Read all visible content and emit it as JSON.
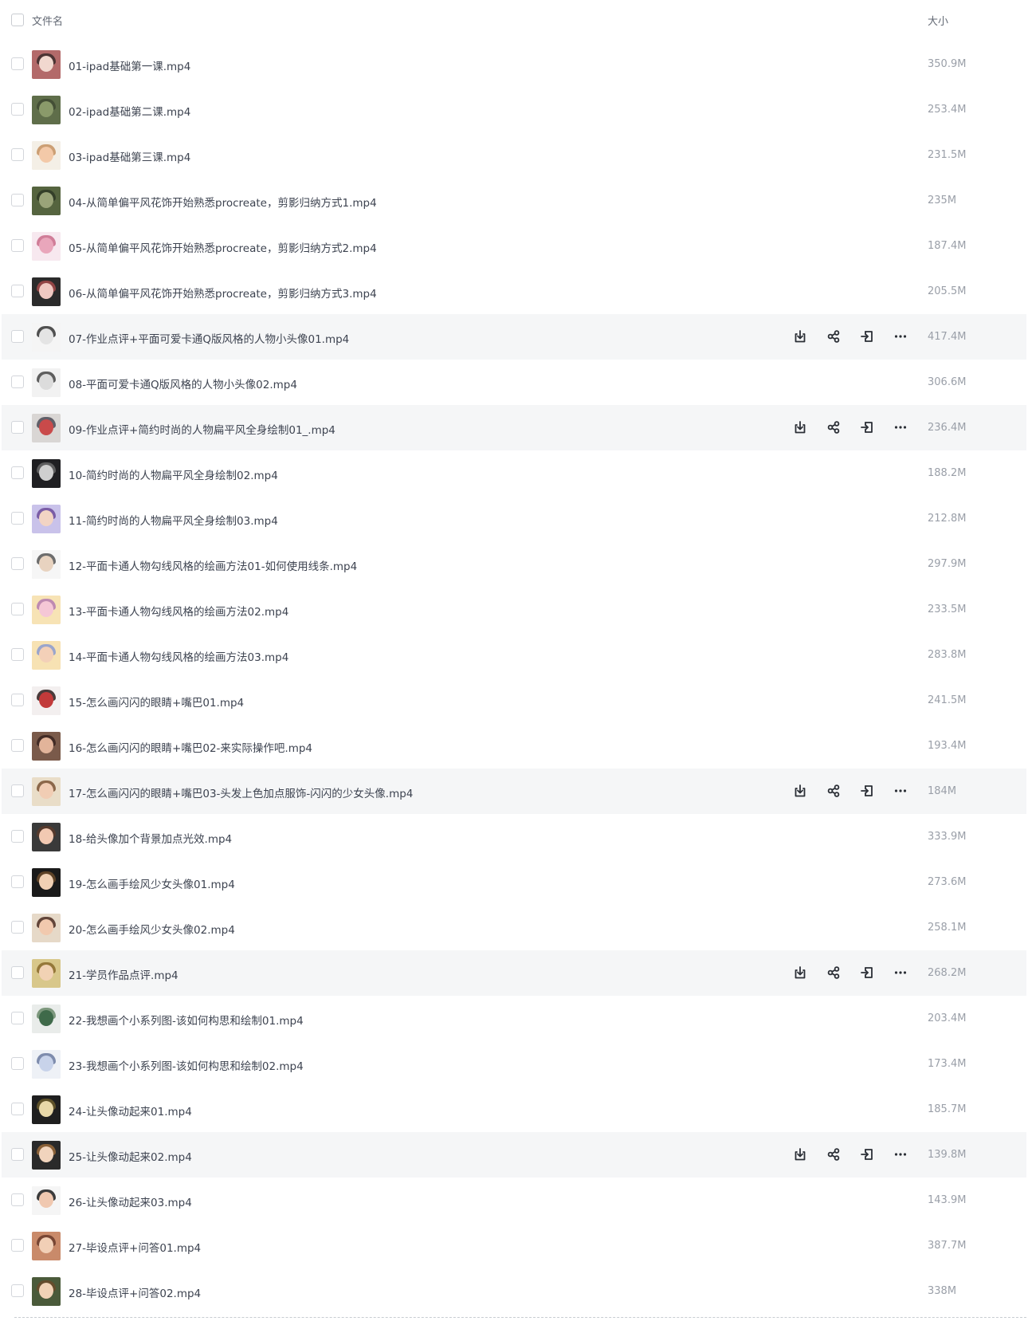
{
  "header": {
    "name_label": "文件名",
    "size_label": "大小"
  },
  "files": [
    {
      "name": "01-ipad基础第一课.mp4",
      "size": "350.9M",
      "hover": false,
      "thumb": [
        "#b36a6a",
        "#f1d8cf",
        "#3a2a2a"
      ]
    },
    {
      "name": "02-ipad基础第二课.mp4",
      "size": "253.4M",
      "hover": false,
      "thumb": [
        "#5f6e4a",
        "#8a9a6a",
        "#3f4a32"
      ]
    },
    {
      "name": "03-ipad基础第三课.mp4",
      "size": "231.5M",
      "hover": false,
      "thumb": [
        "#f4efe6",
        "#f3c9a8",
        "#c4905f"
      ]
    },
    {
      "name": "04-从简单偏平风花饰开始熟悉procreate，剪影归纳方式1.mp4",
      "size": "235M",
      "hover": false,
      "thumb": [
        "#55643f",
        "#9aa479",
        "#2f3826"
      ]
    },
    {
      "name": "05-从简单偏平风花饰开始熟悉procreate，剪影归纳方式2.mp4",
      "size": "187.4M",
      "hover": false,
      "thumb": [
        "#f7e8ef",
        "#e9a6bb",
        "#c96a88"
      ]
    },
    {
      "name": "06-从简单偏平风花饰开始熟悉procreate，剪影归纳方式3.mp4",
      "size": "205.5M",
      "hover": false,
      "thumb": [
        "#2b2b2b",
        "#f0c9c2",
        "#a44a4a"
      ]
    },
    {
      "name": "07-作业点评+平面可爱卡通Q版风格的人物小头像01.mp4",
      "size": "417.4M",
      "hover": true,
      "thumb": [
        "#f5f5f5",
        "#e4e4e4",
        "#333333"
      ]
    },
    {
      "name": "08-平面可爱卡通Q版风格的人物小头像02.mp4",
      "size": "306.6M",
      "hover": false,
      "thumb": [
        "#f2f2f2",
        "#dcdcdc",
        "#444444"
      ]
    },
    {
      "name": "09-作业点评+简约时尚的人物扁平风全身绘制01_.mp4",
      "size": "236.4M",
      "hover": true,
      "thumb": [
        "#d9d6d4",
        "#c94a4a",
        "#4a4a55"
      ]
    },
    {
      "name": "10-简约时尚的人物扁平风全身绘制02.mp4",
      "size": "188.2M",
      "hover": false,
      "thumb": [
        "#1f1f22",
        "#cfcfcf",
        "#6a6a6a"
      ]
    },
    {
      "name": "11-简约时尚的人物扁平风全身绘制03.mp4",
      "size": "212.8M",
      "hover": false,
      "thumb": [
        "#c9c2ea",
        "#f2d4c4",
        "#6c4a9a"
      ]
    },
    {
      "name": "12-平面卡通人物勾线风格的绘画方法01-如何使用线条.mp4",
      "size": "297.9M",
      "hover": false,
      "thumb": [
        "#f6f6f6",
        "#e8d3c0",
        "#555555"
      ]
    },
    {
      "name": "13-平面卡通人物勾线风格的绘画方法02.mp4",
      "size": "233.5M",
      "hover": false,
      "thumb": [
        "#f7e3b5",
        "#f5c7d6",
        "#b47ab0"
      ]
    },
    {
      "name": "14-平面卡通人物勾线风格的绘画方法03.mp4",
      "size": "283.8M",
      "hover": false,
      "thumb": [
        "#f7e2b3",
        "#f3d0b8",
        "#8a9ad0"
      ]
    },
    {
      "name": "15-怎么画闪闪的眼睛+嘴巴01.mp4",
      "size": "241.5M",
      "hover": false,
      "thumb": [
        "#f3efef",
        "#c23a3a",
        "#2a1a1a"
      ]
    },
    {
      "name": "16-怎么画闪闪的眼睛+嘴巴02-来实际操作吧.mp4",
      "size": "193.4M",
      "hover": false,
      "thumb": [
        "#7a5a4a",
        "#e2b49a",
        "#3a2420"
      ]
    },
    {
      "name": "17-怎么画闪闪的眼睛+嘴巴03-头发上色加点服饰-闪闪的少女头像.mp4",
      "size": "184M",
      "hover": true,
      "thumb": [
        "#e9ddc8",
        "#f1cdb4",
        "#7a5233"
      ]
    },
    {
      "name": "18-给头像加个背景加点光效.mp4",
      "size": "333.9M",
      "hover": false,
      "thumb": [
        "#3a3a3a",
        "#f2c9b2",
        "#5a3a2a"
      ]
    },
    {
      "name": "19-怎么画手绘风少女头像01.mp4",
      "size": "273.6M",
      "hover": false,
      "thumb": [
        "#1a1a1a",
        "#f0d0b4",
        "#6a4a2a"
      ]
    },
    {
      "name": "20-怎么画手绘风少女头像02.mp4",
      "size": "258.1M",
      "hover": false,
      "thumb": [
        "#e6d9c8",
        "#f1c9ae",
        "#4a2a20"
      ]
    },
    {
      "name": "21-学员作品点评.mp4",
      "size": "268.2M",
      "hover": true,
      "thumb": [
        "#d8c78a",
        "#f1d2b4",
        "#8a6a2a"
      ]
    },
    {
      "name": "22-我想画个小系列图-该如何构思和绘制01.mp4",
      "size": "203.4M",
      "hover": false,
      "thumb": [
        "#e9ecea",
        "#3f6a4a",
        "#6a8a6a"
      ]
    },
    {
      "name": "23-我想画个小系列图-该如何构思和绘制02.mp4",
      "size": "173.4M",
      "hover": false,
      "thumb": [
        "#eef1f6",
        "#c8d3ea",
        "#6a7aa0"
      ]
    },
    {
      "name": "24-让头像动起来01.mp4",
      "size": "185.7M",
      "hover": false,
      "thumb": [
        "#1f1f1f",
        "#e8d8a8",
        "#6a5a2a"
      ]
    },
    {
      "name": "25-让头像动起来02.mp4",
      "size": "139.8M",
      "hover": true,
      "thumb": [
        "#2a2a2a",
        "#f1d4bd",
        "#9a6a3a"
      ]
    },
    {
      "name": "26-让头像动起来03.mp4",
      "size": "143.9M",
      "hover": false,
      "thumb": [
        "#f5f5f5",
        "#f0c8b0",
        "#1a1a1a"
      ]
    },
    {
      "name": "27-毕设点评+问答01.mp4",
      "size": "387.7M",
      "hover": false,
      "thumb": [
        "#c98a6a",
        "#f1cfb6",
        "#6a3a2a"
      ]
    },
    {
      "name": "28-毕设点评+问答02.mp4",
      "size": "338M",
      "hover": false,
      "thumb": [
        "#4a5a3a",
        "#f1d2b6",
        "#6a4a2a"
      ]
    }
  ],
  "row_actions": [
    "download-icon",
    "share-icon",
    "move-icon",
    "more-icon"
  ],
  "colors": {
    "text": "#3d4350",
    "size_text": "#9a9fa8",
    "hover_bg": "#f5f6f7",
    "icon": "#2b2f36"
  }
}
